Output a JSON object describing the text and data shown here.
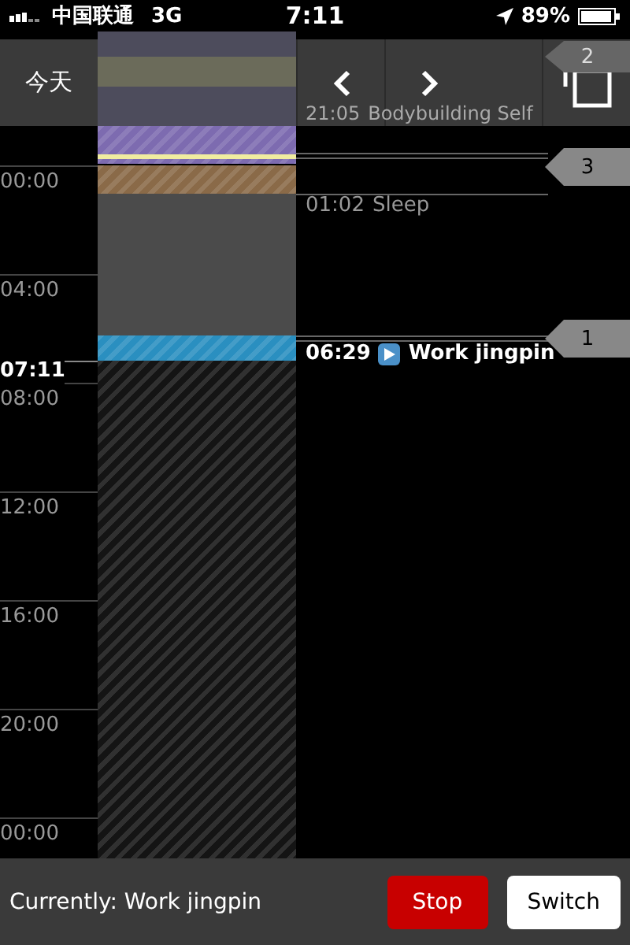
{
  "status_bar": {
    "carrier": "中国联通",
    "network": "3G",
    "time": "7:11",
    "battery": "89%"
  },
  "header": {
    "today_button": "今天"
  },
  "time_labels": [
    "00:00",
    "04:00",
    "08:00",
    "12:00",
    "16:00",
    "20:00",
    "00:00"
  ],
  "now_label": "07:11",
  "blocks": [
    {
      "color": "#4d4c5c",
      "hatched": false
    },
    {
      "color": "#6b6b5a",
      "hatched": false
    },
    {
      "color": "#7d6bb0",
      "hatched": true
    },
    {
      "color": "#f0eca0",
      "hatched": false
    },
    {
      "color": "#8a6a48",
      "hatched": true
    },
    {
      "color": "#4b4b4b",
      "hatched": false
    },
    {
      "color": "#2a8fc0",
      "hatched": true
    },
    {
      "color": "#141414",
      "hatched": true
    }
  ],
  "events": [
    {
      "time": "21:05",
      "title": "Bodybuilding Self",
      "faded": true,
      "playing": false
    },
    {
      "time": "01:02",
      "title": "Sleep",
      "faded": false,
      "playing": false
    },
    {
      "time": "06:29",
      "title": "Work jingpin",
      "faded": false,
      "playing": true
    }
  ],
  "markers": [
    {
      "label": "2",
      "faded": true
    },
    {
      "label": "3",
      "faded": false
    },
    {
      "label": "1",
      "faded": false
    }
  ],
  "footer": {
    "current": "Currently: Work jingpin",
    "buttons": [
      "Stop",
      "Switch"
    ]
  }
}
